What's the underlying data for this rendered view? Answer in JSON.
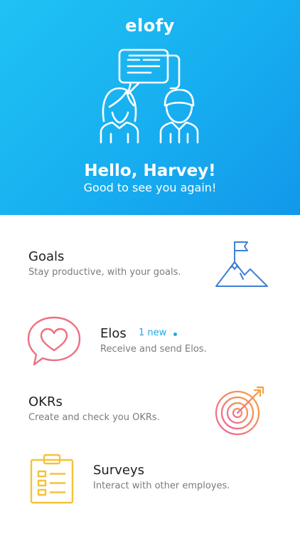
{
  "app": {
    "logo_text": "elofy"
  },
  "header": {
    "greeting": "Hello, Harvey!",
    "subtitle": "Good to see you again!"
  },
  "menu": [
    {
      "title": "Goals",
      "description": "Stay productive, with your goals.",
      "icon": "mountain-flag-icon"
    },
    {
      "title": "Elos",
      "description": "Receive and send Elos.",
      "badge": "1 new",
      "icon": "heart-speech-bubble-icon"
    },
    {
      "title": "OKRs",
      "description": "Create and check you OKRs.",
      "icon": "target-arrow-icon"
    },
    {
      "title": "Surveys",
      "description": "Interact with other employes.",
      "icon": "clipboard-icon"
    }
  ],
  "colors": {
    "header_blue": "#17aef0",
    "badge_blue": "#1ea7e8",
    "goals_icon": "#3d7fd6",
    "elos_icon": "#ee6f80",
    "surveys_icon": "#f5c23a"
  }
}
